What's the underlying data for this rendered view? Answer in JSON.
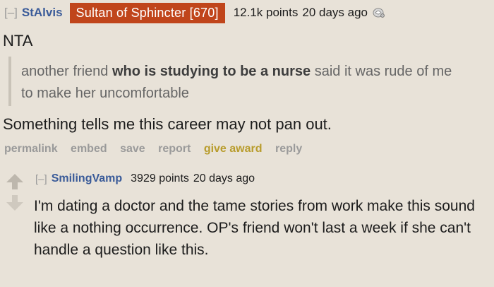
{
  "comment": {
    "collapse_label": "[–]",
    "author": "StAlvis",
    "flair": "Sultan of Sphincter [670]",
    "points": "12.1k points",
    "time": "20 days ago",
    "award_icon": "silver-award-icon",
    "line1": "NTA",
    "quote": {
      "part1": "another friend ",
      "bold": "who is studying to be a nurse",
      "part2": " said it was rude of me to make her uncomfortable"
    },
    "line2": "Something tells me this career may not pan out.",
    "links": [
      "permalink",
      "embed",
      "save",
      "report",
      "give award",
      "reply"
    ]
  },
  "reply": {
    "collapse_label": "[–]",
    "author": "SmilingVamp",
    "points": "3929 points",
    "time": "20 days ago",
    "body": "I'm dating a doctor and the tame stories from work make this sound like a nothing occurrence. OP's friend won't last a week if she can't handle a question like this."
  },
  "colors": {
    "background": "#e8e2d8",
    "flair_bg": "#c0451b",
    "author": "#3a5b99",
    "award_link": "#b89c2c"
  }
}
